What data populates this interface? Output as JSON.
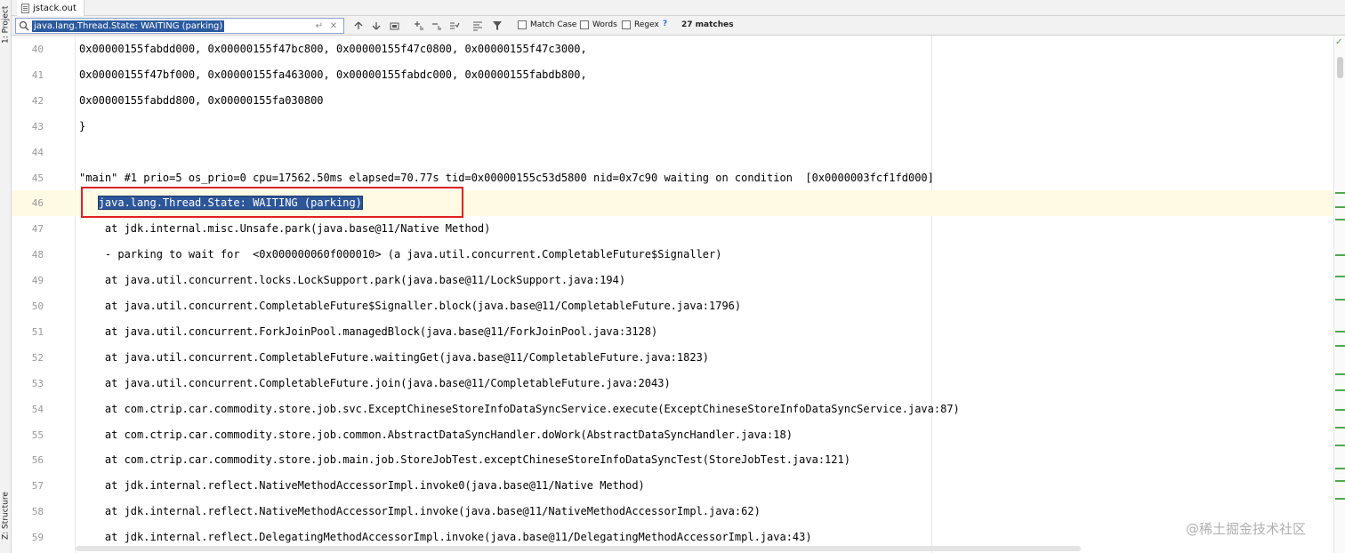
{
  "left_strip": {
    "project_label": "1: Project",
    "structure_label": "Z: Structure"
  },
  "tab": {
    "filename": "jstack.out"
  },
  "search": {
    "query": "java.lang.Thread.State: WAITING (parking)",
    "match_case_label": "Match Case",
    "words_label": "Words",
    "regex_label": "Regex",
    "help_label": "?",
    "match_count": "27 matches"
  },
  "editor": {
    "current_line": "46",
    "lines": [
      {
        "num": "40",
        "text": "0x00000155fabdd000, 0x00000155f47bc800, 0x00000155f47c0800, 0x00000155f47c3000,"
      },
      {
        "num": "41",
        "text": "0x00000155f47bf000, 0x00000155fa463000, 0x00000155fabdc000, 0x00000155fabdb800,"
      },
      {
        "num": "42",
        "text": "0x00000155fabdd800, 0x00000155fa030800"
      },
      {
        "num": "43",
        "text": "}"
      },
      {
        "num": "44",
        "text": ""
      },
      {
        "num": "45",
        "text": "\"main\" #1 prio=5 os_prio=0 cpu=17562.50ms elapsed=70.77s tid=0x00000155c53d5800 nid=0x7c90 waiting on condition  [0x0000003fcf1fd000]"
      },
      {
        "num": "46",
        "indent": "   ",
        "text": "java.lang.Thread.State: WAITING (parking)"
      },
      {
        "num": "47",
        "text": "    at jdk.internal.misc.Unsafe.park(java.base@11/Native Method)"
      },
      {
        "num": "48",
        "text": "    - parking to wait for  <0x000000060f000010> (a java.util.concurrent.CompletableFuture$Signaller)"
      },
      {
        "num": "49",
        "text": "    at java.util.concurrent.locks.LockSupport.park(java.base@11/LockSupport.java:194)"
      },
      {
        "num": "50",
        "text": "    at java.util.concurrent.CompletableFuture$Signaller.block(java.base@11/CompletableFuture.java:1796)"
      },
      {
        "num": "51",
        "text": "    at java.util.concurrent.ForkJoinPool.managedBlock(java.base@11/ForkJoinPool.java:3128)"
      },
      {
        "num": "52",
        "text": "    at java.util.concurrent.CompletableFuture.waitingGet(java.base@11/CompletableFuture.java:1823)"
      },
      {
        "num": "53",
        "text": "    at java.util.concurrent.CompletableFuture.join(java.base@11/CompletableFuture.java:2043)"
      },
      {
        "num": "54",
        "text": "    at com.ctrip.car.commodity.store.job.svc.ExceptChineseStoreInfoDataSyncService.execute(ExceptChineseStoreInfoDataSyncService.java:87)"
      },
      {
        "num": "55",
        "text": "    at com.ctrip.car.commodity.store.job.common.AbstractDataSyncHandler.doWork(AbstractDataSyncHandler.java:18)"
      },
      {
        "num": "56",
        "text": "    at com.ctrip.car.commodity.store.job.main.job.StoreJobTest.exceptChineseStoreInfoDataSyncTest(StoreJobTest.java:121)"
      },
      {
        "num": "57",
        "text": "    at jdk.internal.reflect.NativeMethodAccessorImpl.invoke0(java.base@11/Native Method)"
      },
      {
        "num": "58",
        "text": "    at jdk.internal.reflect.NativeMethodAccessorImpl.invoke(java.base@11/NativeMethodAccessorImpl.java:62)"
      },
      {
        "num": "59",
        "text": "    at jdk.internal.reflect.DelegatingMethodAccessorImpl.invoke(java.base@11/DelegatingMethodAccessorImpl.java:43)"
      }
    ]
  },
  "watermark": "@稀土掘金技术社区",
  "colors": {
    "selection": "#2d5699",
    "current_line_bg": "#fffae3",
    "annotation_box": "#e02020",
    "match_marker": "#51a851"
  }
}
